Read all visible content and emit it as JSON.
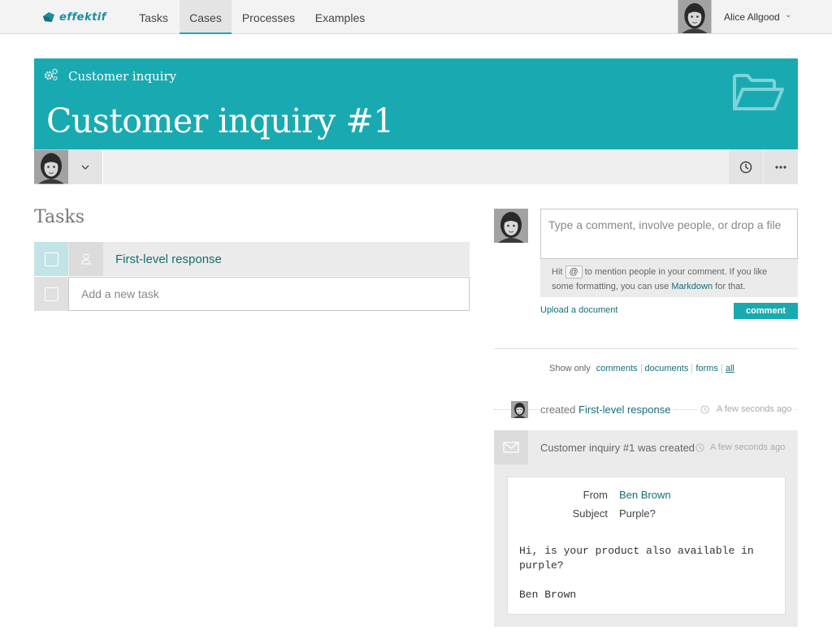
{
  "brand": {
    "name": "effektif",
    "color": "#1a8ea3"
  },
  "nav": {
    "items": [
      {
        "label": "Tasks",
        "active": false
      },
      {
        "label": "Cases",
        "active": true
      },
      {
        "label": "Processes",
        "active": false
      },
      {
        "label": "Examples",
        "active": false
      }
    ]
  },
  "user": {
    "name": "Alice Allgood"
  },
  "case": {
    "process_name": "Customer inquiry",
    "title": "Customer inquiry #1",
    "accent_color": "#19aab1"
  },
  "tasks": {
    "heading": "Tasks",
    "items": [
      {
        "name": "First-level response",
        "done": false
      }
    ],
    "new_task_placeholder": "Add a new task"
  },
  "comment": {
    "placeholder": "Type a comment, involve people, or drop a file",
    "hint_pre": "Hit",
    "hint_key": "@",
    "hint_mid": "to mention people in your comment. If you like some formatting, you can use",
    "hint_link": "Markdown",
    "hint_post": "for that.",
    "upload_label": "Upload a document",
    "submit_label": "comment"
  },
  "filters": {
    "label": "Show only",
    "options": [
      "comments",
      "documents",
      "forms",
      "all"
    ],
    "selected": "all"
  },
  "activity": [
    {
      "action": "created",
      "target": "First-level response",
      "time": "A few seconds ago"
    },
    {
      "text": "Customer inquiry #1 was created",
      "time": "A few seconds ago",
      "email": {
        "from_label": "From",
        "from_value": "Ben Brown",
        "subject_label": "Subject",
        "subject_value": "Purple?",
        "body": "Hi, is your product also available in purple?\n\nBen Brown"
      }
    }
  ]
}
